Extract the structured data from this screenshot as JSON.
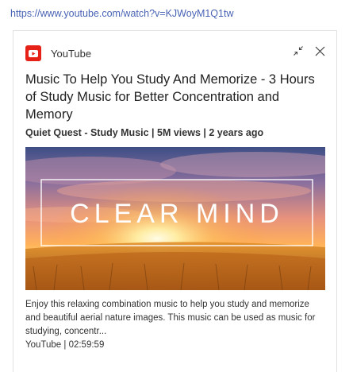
{
  "url": "https://www.youtube.com/watch?v=KJWoyM1Q1tw",
  "card": {
    "source_icon": "youtube-logo-icon",
    "source": "YouTube",
    "collapse_icon": "collapse-arrows-icon",
    "close_icon": "close-icon",
    "title": "Music To Help You Study And Memorize - 3 Hours of Study Music for Better Concentration and Memory",
    "meta": "Quiet Quest - Study Music | 5M views | 2 years ago",
    "thumbnail_text": "CLEAR MIND",
    "description": "Enjoy this relaxing combination music to help you study and memorize and beautiful aerial nature images. This music can be used as music for studying, concentr...",
    "footer": "YouTube | 02:59:59"
  },
  "colors": {
    "link": "#4a64b5",
    "brand_red": "#e62117"
  }
}
